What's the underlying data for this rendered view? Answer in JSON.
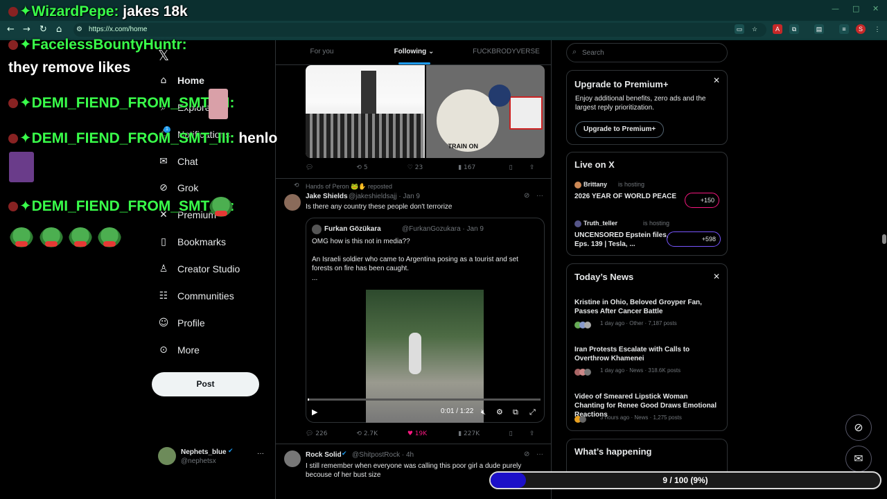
{
  "browser": {
    "url": "https://x.com/home",
    "profile_initial": "S"
  },
  "nav": {
    "home": "Home",
    "explore": "Explore",
    "notifications": "Notifications",
    "notif_count": "1",
    "chat": "Chat",
    "grok": "Grok",
    "premium": "Premium",
    "bookmarks": "Bookmarks",
    "creator_studio": "Creator Studio",
    "communities": "Communities",
    "profile": "Profile",
    "more": "More",
    "post": "Post",
    "account_name": "Nephets_blue",
    "account_handle": "@nephetsx"
  },
  "feed": {
    "tabs": [
      "For you",
      "Following",
      "FUCKBRODYVERSE"
    ],
    "first": {
      "replies": "",
      "reposts": "5",
      "likes": "23",
      "views": "167",
      "sticker_text": "TRAIN ON"
    },
    "second": {
      "repost_by": "Hands of Peron 🐸✋ reposted",
      "name": "Jake Shields",
      "handle": "@jakeshieldsajj · Jan 9",
      "text": "Is there any country these people don't terrorize",
      "quote_name": "Furkan Gözükara",
      "quote_handle": "@FurkanGozukara · Jan 9",
      "quote_line1": "OMG how is this not in media??",
      "quote_line2": "An Israeli soldier who came to Argentina posing as a tourist and set forests on fire has been caught.",
      "quote_ellipsis": "...",
      "video_time": "0:01 / 1:22",
      "replies": "226",
      "reposts": "2.7K",
      "likes": "19K",
      "views": "227K"
    },
    "third": {
      "name": "Rock Solid",
      "handle": "@ShitpostRock · 4h",
      "text": "I still remember when everyone was calling this poor girl a dude purely becouse of her bust size"
    }
  },
  "sidebar": {
    "search_placeholder": "Search",
    "premium": {
      "title": "Upgrade to Premium+",
      "body": "Enjoy additional benefits, zero ads and the largest reply prioritization.",
      "button": "Upgrade to Premium+"
    },
    "live": {
      "title": "Live on X",
      "items": [
        {
          "host": "Brittany",
          "status": "is hosting",
          "title": "2026 YEAR OF WORLD PEACE",
          "count": "+150"
        },
        {
          "host": "Truth_teller",
          "status": "is hosting",
          "title": "UNCENSORED Epstein files, Eps. 139 | Tesla, ...",
          "count": "+598"
        }
      ]
    },
    "news": {
      "title": "Today’s News",
      "items": [
        {
          "headline": "Kristine in Ohio, Beloved Groyper Fan, Passes After Cancer Battle",
          "meta": "1 day ago · Other · 7,187 posts"
        },
        {
          "headline": "Iran Protests Escalate with Calls to Overthrow Khamenei",
          "meta": "1 day ago · News · 318.6K posts"
        },
        {
          "headline": "Video of Smeared Lipstick Woman Chanting for Renee Good Draws Emotional Reactions",
          "meta": "3 hours ago · News · 1,275 posts"
        }
      ]
    },
    "happening": "What’s happening"
  },
  "overlay": {
    "chat": [
      {
        "user": "WizardPepe:",
        "msg": "jakes 18k"
      },
      {
        "user": "FacelessBountyHuntr:",
        "msg": "they remove likes"
      },
      {
        "user": "DEMI_FIEND_FROM_SMT_III:",
        "msg": ""
      },
      {
        "user": "DEMI_FIEND_FROM_SMT_III:",
        "msg": "henlo"
      },
      {
        "user": "DEMI_FIEND_FROM_SMT_III:",
        "msg": ""
      }
    ],
    "progress_label": "9 / 100 (9%)",
    "progress_fraction": 0.09
  }
}
